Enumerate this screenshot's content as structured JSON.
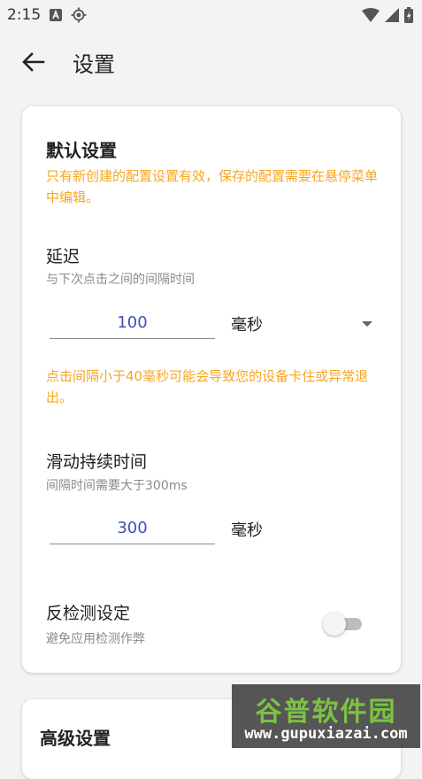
{
  "status": {
    "time": "2:15"
  },
  "app_bar": {
    "title": "设置"
  },
  "default_settings": {
    "title": "默认设置",
    "warning": "只有新创建的配置设置有效，保存的配置需要在悬停菜单中编辑。",
    "delay": {
      "label": "延迟",
      "hint": "与下次点击之间的间隔时间",
      "value": "100",
      "unit": "毫秒",
      "warning": "点击间隔小于40毫秒可能会导致您的设备卡住或异常退出。"
    },
    "swipe": {
      "label": "滑动持续时间",
      "hint": "间隔时间需要大于300ms",
      "value": "300",
      "unit": "毫秒"
    },
    "anti_detect": {
      "label": "反检测设定",
      "hint": "避免应用检测作弊",
      "enabled": false
    }
  },
  "advanced_settings": {
    "title": "高级设置"
  },
  "watermark": {
    "title": "谷普软件园",
    "url": "www.gupuxiazai.com"
  },
  "colors": {
    "accent": "#3f51b5",
    "warning": "#f5a623",
    "background": "#f3f3f3"
  }
}
